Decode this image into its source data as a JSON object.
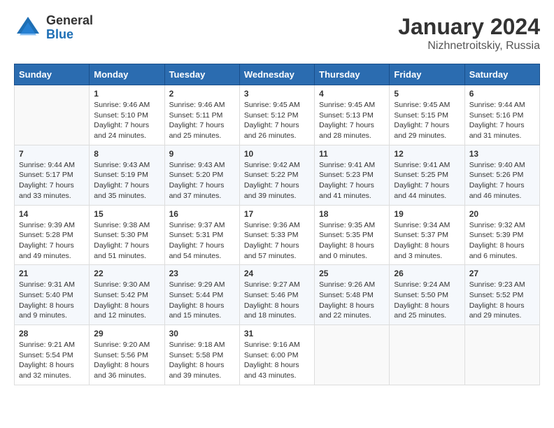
{
  "header": {
    "logo": {
      "general": "General",
      "blue": "Blue"
    },
    "title": "January 2024",
    "location": "Nizhnetroitskiy, Russia"
  },
  "calendar": {
    "weekdays": [
      "Sunday",
      "Monday",
      "Tuesday",
      "Wednesday",
      "Thursday",
      "Friday",
      "Saturday"
    ],
    "weeks": [
      [
        {
          "day": null,
          "sunrise": null,
          "sunset": null,
          "daylight": null
        },
        {
          "day": "1",
          "sunrise": "Sunrise: 9:46 AM",
          "sunset": "Sunset: 5:10 PM",
          "daylight": "Daylight: 7 hours and 24 minutes."
        },
        {
          "day": "2",
          "sunrise": "Sunrise: 9:46 AM",
          "sunset": "Sunset: 5:11 PM",
          "daylight": "Daylight: 7 hours and 25 minutes."
        },
        {
          "day": "3",
          "sunrise": "Sunrise: 9:45 AM",
          "sunset": "Sunset: 5:12 PM",
          "daylight": "Daylight: 7 hours and 26 minutes."
        },
        {
          "day": "4",
          "sunrise": "Sunrise: 9:45 AM",
          "sunset": "Sunset: 5:13 PM",
          "daylight": "Daylight: 7 hours and 28 minutes."
        },
        {
          "day": "5",
          "sunrise": "Sunrise: 9:45 AM",
          "sunset": "Sunset: 5:15 PM",
          "daylight": "Daylight: 7 hours and 29 minutes."
        },
        {
          "day": "6",
          "sunrise": "Sunrise: 9:44 AM",
          "sunset": "Sunset: 5:16 PM",
          "daylight": "Daylight: 7 hours and 31 minutes."
        }
      ],
      [
        {
          "day": "7",
          "sunrise": "Sunrise: 9:44 AM",
          "sunset": "Sunset: 5:17 PM",
          "daylight": "Daylight: 7 hours and 33 minutes."
        },
        {
          "day": "8",
          "sunrise": "Sunrise: 9:43 AM",
          "sunset": "Sunset: 5:19 PM",
          "daylight": "Daylight: 7 hours and 35 minutes."
        },
        {
          "day": "9",
          "sunrise": "Sunrise: 9:43 AM",
          "sunset": "Sunset: 5:20 PM",
          "daylight": "Daylight: 7 hours and 37 minutes."
        },
        {
          "day": "10",
          "sunrise": "Sunrise: 9:42 AM",
          "sunset": "Sunset: 5:22 PM",
          "daylight": "Daylight: 7 hours and 39 minutes."
        },
        {
          "day": "11",
          "sunrise": "Sunrise: 9:41 AM",
          "sunset": "Sunset: 5:23 PM",
          "daylight": "Daylight: 7 hours and 41 minutes."
        },
        {
          "day": "12",
          "sunrise": "Sunrise: 9:41 AM",
          "sunset": "Sunset: 5:25 PM",
          "daylight": "Daylight: 7 hours and 44 minutes."
        },
        {
          "day": "13",
          "sunrise": "Sunrise: 9:40 AM",
          "sunset": "Sunset: 5:26 PM",
          "daylight": "Daylight: 7 hours and 46 minutes."
        }
      ],
      [
        {
          "day": "14",
          "sunrise": "Sunrise: 9:39 AM",
          "sunset": "Sunset: 5:28 PM",
          "daylight": "Daylight: 7 hours and 49 minutes."
        },
        {
          "day": "15",
          "sunrise": "Sunrise: 9:38 AM",
          "sunset": "Sunset: 5:30 PM",
          "daylight": "Daylight: 7 hours and 51 minutes."
        },
        {
          "day": "16",
          "sunrise": "Sunrise: 9:37 AM",
          "sunset": "Sunset: 5:31 PM",
          "daylight": "Daylight: 7 hours and 54 minutes."
        },
        {
          "day": "17",
          "sunrise": "Sunrise: 9:36 AM",
          "sunset": "Sunset: 5:33 PM",
          "daylight": "Daylight: 7 hours and 57 minutes."
        },
        {
          "day": "18",
          "sunrise": "Sunrise: 9:35 AM",
          "sunset": "Sunset: 5:35 PM",
          "daylight": "Daylight: 8 hours and 0 minutes."
        },
        {
          "day": "19",
          "sunrise": "Sunrise: 9:34 AM",
          "sunset": "Sunset: 5:37 PM",
          "daylight": "Daylight: 8 hours and 3 minutes."
        },
        {
          "day": "20",
          "sunrise": "Sunrise: 9:32 AM",
          "sunset": "Sunset: 5:39 PM",
          "daylight": "Daylight: 8 hours and 6 minutes."
        }
      ],
      [
        {
          "day": "21",
          "sunrise": "Sunrise: 9:31 AM",
          "sunset": "Sunset: 5:40 PM",
          "daylight": "Daylight: 8 hours and 9 minutes."
        },
        {
          "day": "22",
          "sunrise": "Sunrise: 9:30 AM",
          "sunset": "Sunset: 5:42 PM",
          "daylight": "Daylight: 8 hours and 12 minutes."
        },
        {
          "day": "23",
          "sunrise": "Sunrise: 9:29 AM",
          "sunset": "Sunset: 5:44 PM",
          "daylight": "Daylight: 8 hours and 15 minutes."
        },
        {
          "day": "24",
          "sunrise": "Sunrise: 9:27 AM",
          "sunset": "Sunset: 5:46 PM",
          "daylight": "Daylight: 8 hours and 18 minutes."
        },
        {
          "day": "25",
          "sunrise": "Sunrise: 9:26 AM",
          "sunset": "Sunset: 5:48 PM",
          "daylight": "Daylight: 8 hours and 22 minutes."
        },
        {
          "day": "26",
          "sunrise": "Sunrise: 9:24 AM",
          "sunset": "Sunset: 5:50 PM",
          "daylight": "Daylight: 8 hours and 25 minutes."
        },
        {
          "day": "27",
          "sunrise": "Sunrise: 9:23 AM",
          "sunset": "Sunset: 5:52 PM",
          "daylight": "Daylight: 8 hours and 29 minutes."
        }
      ],
      [
        {
          "day": "28",
          "sunrise": "Sunrise: 9:21 AM",
          "sunset": "Sunset: 5:54 PM",
          "daylight": "Daylight: 8 hours and 32 minutes."
        },
        {
          "day": "29",
          "sunrise": "Sunrise: 9:20 AM",
          "sunset": "Sunset: 5:56 PM",
          "daylight": "Daylight: 8 hours and 36 minutes."
        },
        {
          "day": "30",
          "sunrise": "Sunrise: 9:18 AM",
          "sunset": "Sunset: 5:58 PM",
          "daylight": "Daylight: 8 hours and 39 minutes."
        },
        {
          "day": "31",
          "sunrise": "Sunrise: 9:16 AM",
          "sunset": "Sunset: 6:00 PM",
          "daylight": "Daylight: 8 hours and 43 minutes."
        },
        {
          "day": null,
          "sunrise": null,
          "sunset": null,
          "daylight": null
        },
        {
          "day": null,
          "sunrise": null,
          "sunset": null,
          "daylight": null
        },
        {
          "day": null,
          "sunrise": null,
          "sunset": null,
          "daylight": null
        }
      ]
    ]
  }
}
